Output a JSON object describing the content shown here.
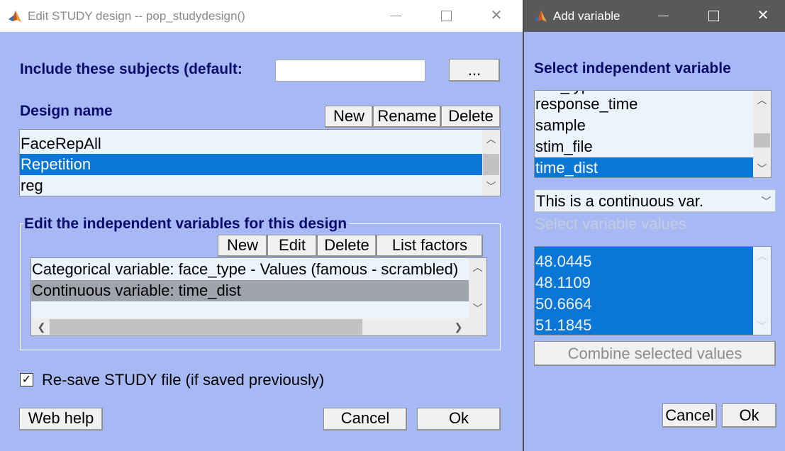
{
  "main_window": {
    "title": "Edit STUDY design -- pop_studydesign()",
    "include_label": "Include these subjects (default:",
    "include_value": "",
    "browse_button": "...",
    "design_name_label": "Design name",
    "design_buttons": {
      "new": "New",
      "rename": "Rename",
      "delete": "Delete"
    },
    "designs": [
      "FaceRepAll",
      "Repetition",
      "reg"
    ],
    "selected_design": "Repetition",
    "variables_group_label": "Edit the independent variables for this design",
    "variable_buttons": {
      "new": "New",
      "edit": "Edit",
      "delete": "Delete",
      "list_factors": "List factors"
    },
    "variables": [
      "Categorical variable: face_type - Values (famous - scrambled)",
      "Continuous variable: time_dist"
    ],
    "selected_variable": "Continuous variable: time_dist",
    "resave_checked": true,
    "resave_label": "Re-save STUDY file (if saved previously)",
    "web_help": "Web help",
    "cancel": "Cancel",
    "ok": "Ok"
  },
  "add_variable_window": {
    "title": "Add variable",
    "select_label": "Select independent variable",
    "partial_item": "trial_type",
    "variables": [
      "response_time",
      "sample",
      "stim_file",
      "time_dist"
    ],
    "selected_variable": "time_dist",
    "variable_type": "This is a continuous var.",
    "values_label": "Select variable values",
    "values": [
      "48.0445",
      "48.1109",
      "50.6664",
      "51.1845"
    ],
    "combine_button": "Combine selected values",
    "cancel": "Cancel",
    "ok": "Ok"
  },
  "colors": {
    "dialog_background": "#a7b9f5",
    "label_text": "#0b0b6b",
    "selection": "#0a77d6",
    "selection_inactive": "#a0a4ac",
    "list_background": "#ebf3fd"
  },
  "icons": [
    "matlab-logo-icon",
    "minimize-icon",
    "maximize-icon",
    "close-icon",
    "scroll-up-icon",
    "scroll-down-icon",
    "scroll-left-icon",
    "scroll-right-icon",
    "checkmark-icon",
    "dropdown-chevron-icon"
  ]
}
